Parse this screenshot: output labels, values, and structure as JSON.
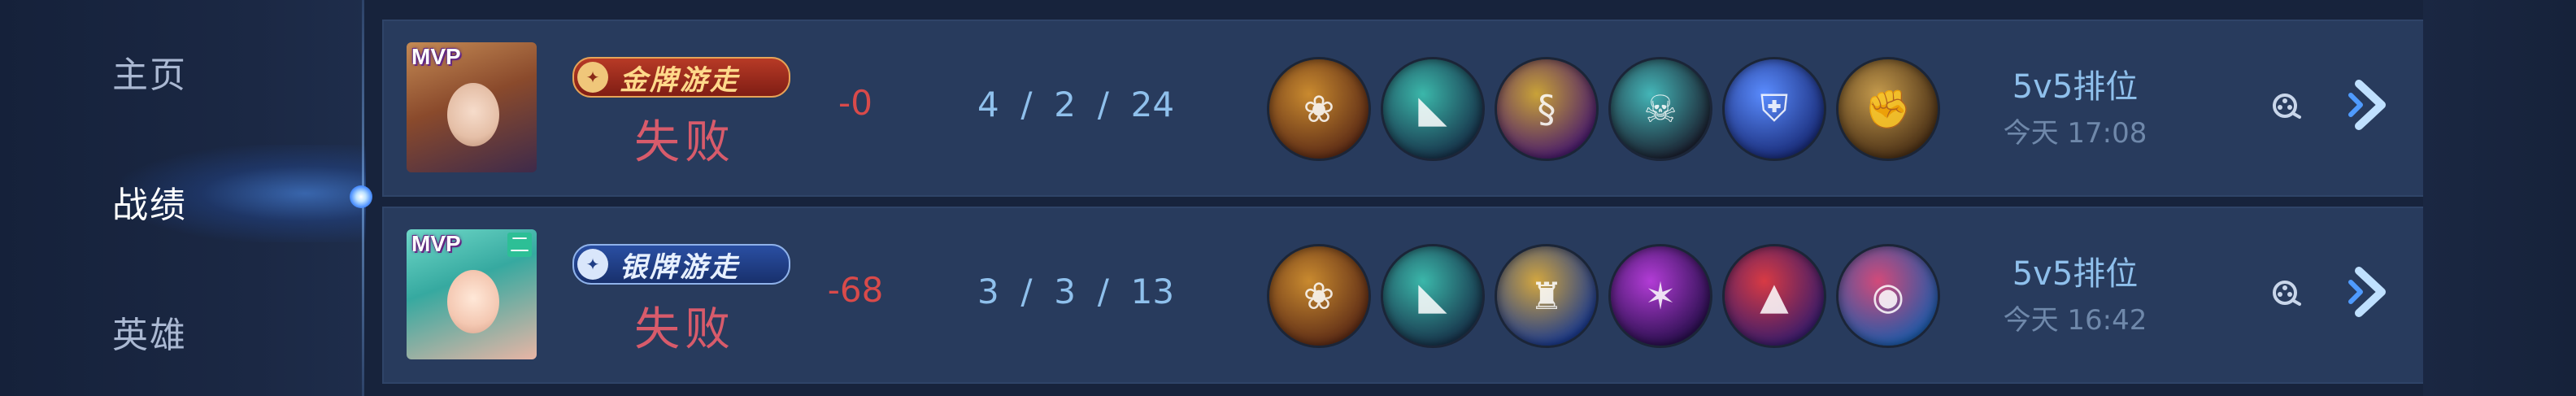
{
  "sidebar": {
    "items": [
      {
        "label": "主页",
        "active": false
      },
      {
        "label": "战绩",
        "active": true
      },
      {
        "label": "英雄",
        "active": false
      }
    ]
  },
  "matches": [
    {
      "mvp": "MVP",
      "rank_tag": "",
      "badge": "金牌游走",
      "badge_style": "gold",
      "result": "失败",
      "score": "-0",
      "kills": "4",
      "deaths": "2",
      "assists": "24",
      "items": [
        {
          "icon": "green-swirl-shield-icon",
          "color_a": "#c98a2f",
          "color_b": "#5d2c16"
        },
        {
          "icon": "armored-boots-icon",
          "color_a": "#3bb7aa",
          "color_b": "#17334a"
        },
        {
          "icon": "golden-cobra-icon",
          "color_a": "#c9a238",
          "color_b": "#4a1d6a"
        },
        {
          "icon": "skull-mask-icon",
          "color_a": "#44b6b8",
          "color_b": "#1b2231"
        },
        {
          "icon": "blue-armor-icon",
          "color_a": "#5a8cff",
          "color_b": "#1a2d7a"
        },
        {
          "icon": "brown-gauntlet-icon",
          "color_a": "#c49a4c",
          "color_b": "#4a3016"
        }
      ],
      "mode": "5v5排位",
      "time": "今天 17:08"
    },
    {
      "mvp": "MVP",
      "rank_tag": "二",
      "badge": "银牌游走",
      "badge_style": "silver",
      "result": "失败",
      "score": "-68",
      "kills": "3",
      "deaths": "3",
      "assists": "13",
      "items": [
        {
          "icon": "green-swirl-shield-icon",
          "color_a": "#c98a2f",
          "color_b": "#5d2c16"
        },
        {
          "icon": "armored-boots-icon",
          "color_a": "#3bb7aa",
          "color_b": "#17334a"
        },
        {
          "icon": "golden-chalice-icon",
          "color_a": "#d2a640",
          "color_b": "#1c3a8a"
        },
        {
          "icon": "purple-claw-icon",
          "color_a": "#b23cd6",
          "color_b": "#2a0f4e"
        },
        {
          "icon": "red-wizard-hat-icon",
          "color_a": "#d83a44",
          "color_b": "#3a1c6a"
        },
        {
          "icon": "crimson-orb-icon",
          "color_a": "#d24a7a",
          "color_b": "#1f5aa8"
        }
      ],
      "mode": "5v5排位",
      "time": "今天 16:42"
    }
  ],
  "colors": {
    "background": "#17233c",
    "row": "#283b5d",
    "loss_text": "#d85b6b",
    "score_negative": "#d94a4a",
    "kda": "#8fc0ec",
    "time": "#6f88aa"
  }
}
